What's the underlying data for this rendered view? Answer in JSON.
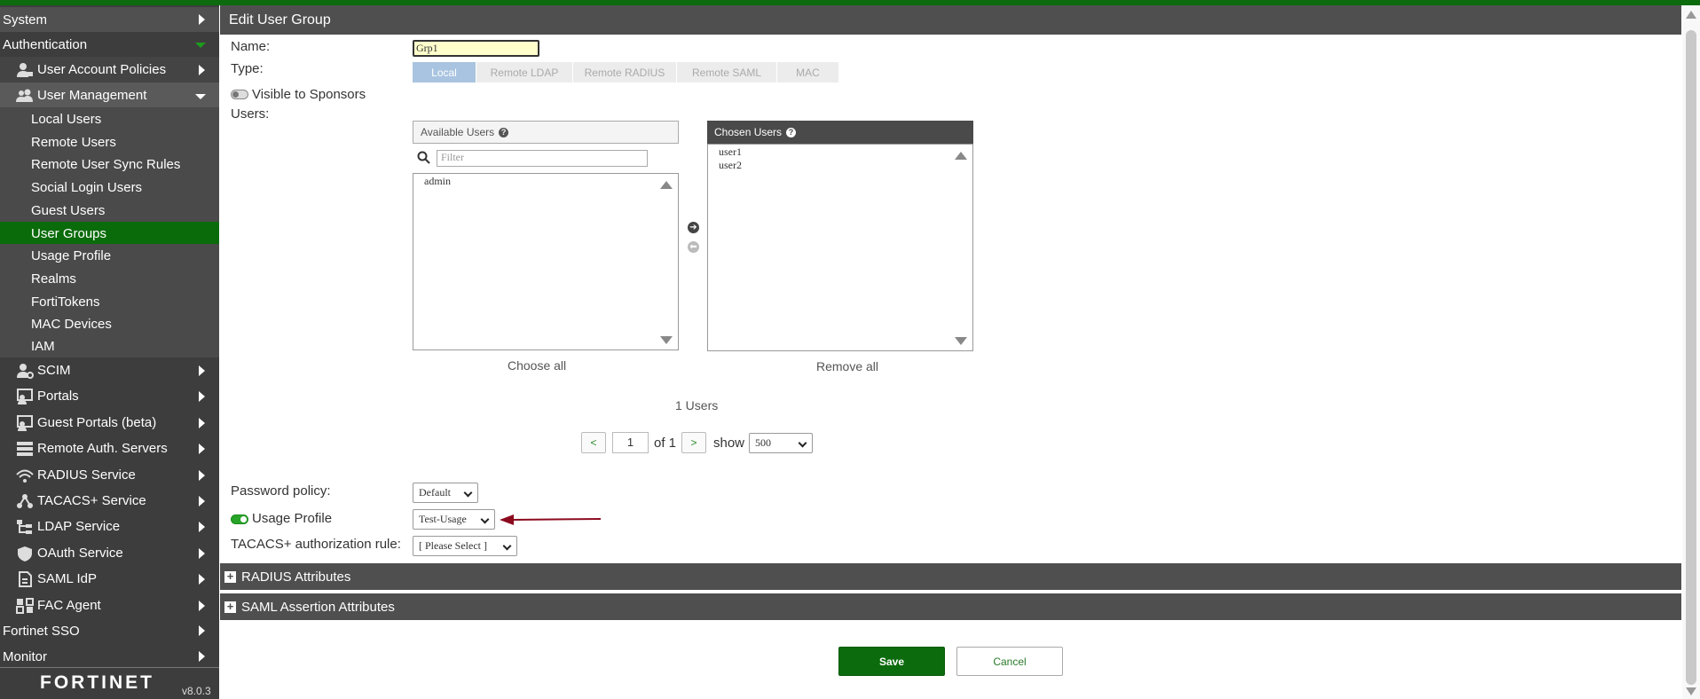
{
  "sidebar": {
    "system": "System",
    "authentication": "Authentication",
    "user_account_policies": "User Account Policies",
    "user_management": "User Management",
    "sub_items": [
      "Local Users",
      "Remote Users",
      "Remote User Sync Rules",
      "Social Login Users",
      "Guest Users",
      "User Groups",
      "Usage Profile",
      "Realms",
      "FortiTokens",
      "MAC Devices",
      "IAM"
    ],
    "active_item": "User Groups",
    "sections": [
      "SCIM",
      "Portals",
      "Guest Portals (beta)",
      "Remote Auth. Servers",
      "RADIUS Service",
      "TACACS+ Service",
      "LDAP Service",
      "OAuth Service",
      "SAML IdP",
      "FAC Agent"
    ],
    "fortinet_sso": "Fortinet SSO",
    "monitor": "Monitor",
    "brand": "FORTINET",
    "version": "v8.0.3"
  },
  "header": {
    "title": "Edit User Group"
  },
  "form": {
    "name_label": "Name:",
    "name_value": "Grp1",
    "type_label": "Type:",
    "type_options": [
      "Local",
      "Remote LDAP",
      "Remote RADIUS",
      "Remote SAML",
      "MAC"
    ],
    "type_selected": "Local",
    "visible_to_sponsors": "Visible to Sponsors",
    "visible_to_sponsors_on": false,
    "users_label": "Users:",
    "available_users_title": "Available Users",
    "filter_placeholder": "Filter",
    "available_users": [
      "admin"
    ],
    "chosen_users_title": "Chosen Users",
    "chosen_users": [
      "user1",
      "user2"
    ],
    "choose_all": "Choose all",
    "remove_all": "Remove all",
    "users_count": "1 Users",
    "pagination": {
      "prev": "<",
      "page": "1",
      "of": "of 1",
      "next": ">",
      "show": "show",
      "page_size": "500"
    },
    "password_policy_label": "Password policy:",
    "password_policy_value": "Default",
    "usage_profile_label": "Usage Profile",
    "usage_profile_on": true,
    "usage_profile_value": "Test-Usage",
    "tacacs_label": "TACACS+ authorization rule:",
    "tacacs_value": "[ Please Select ]"
  },
  "accordions": {
    "radius": "RADIUS Attributes",
    "saml": "SAML Assertion Attributes"
  },
  "buttons": {
    "save": "Save",
    "cancel": "Cancel"
  },
  "colors": {
    "accent": "#0c6b0c",
    "annotation_arrow": "#8b0a1e"
  }
}
